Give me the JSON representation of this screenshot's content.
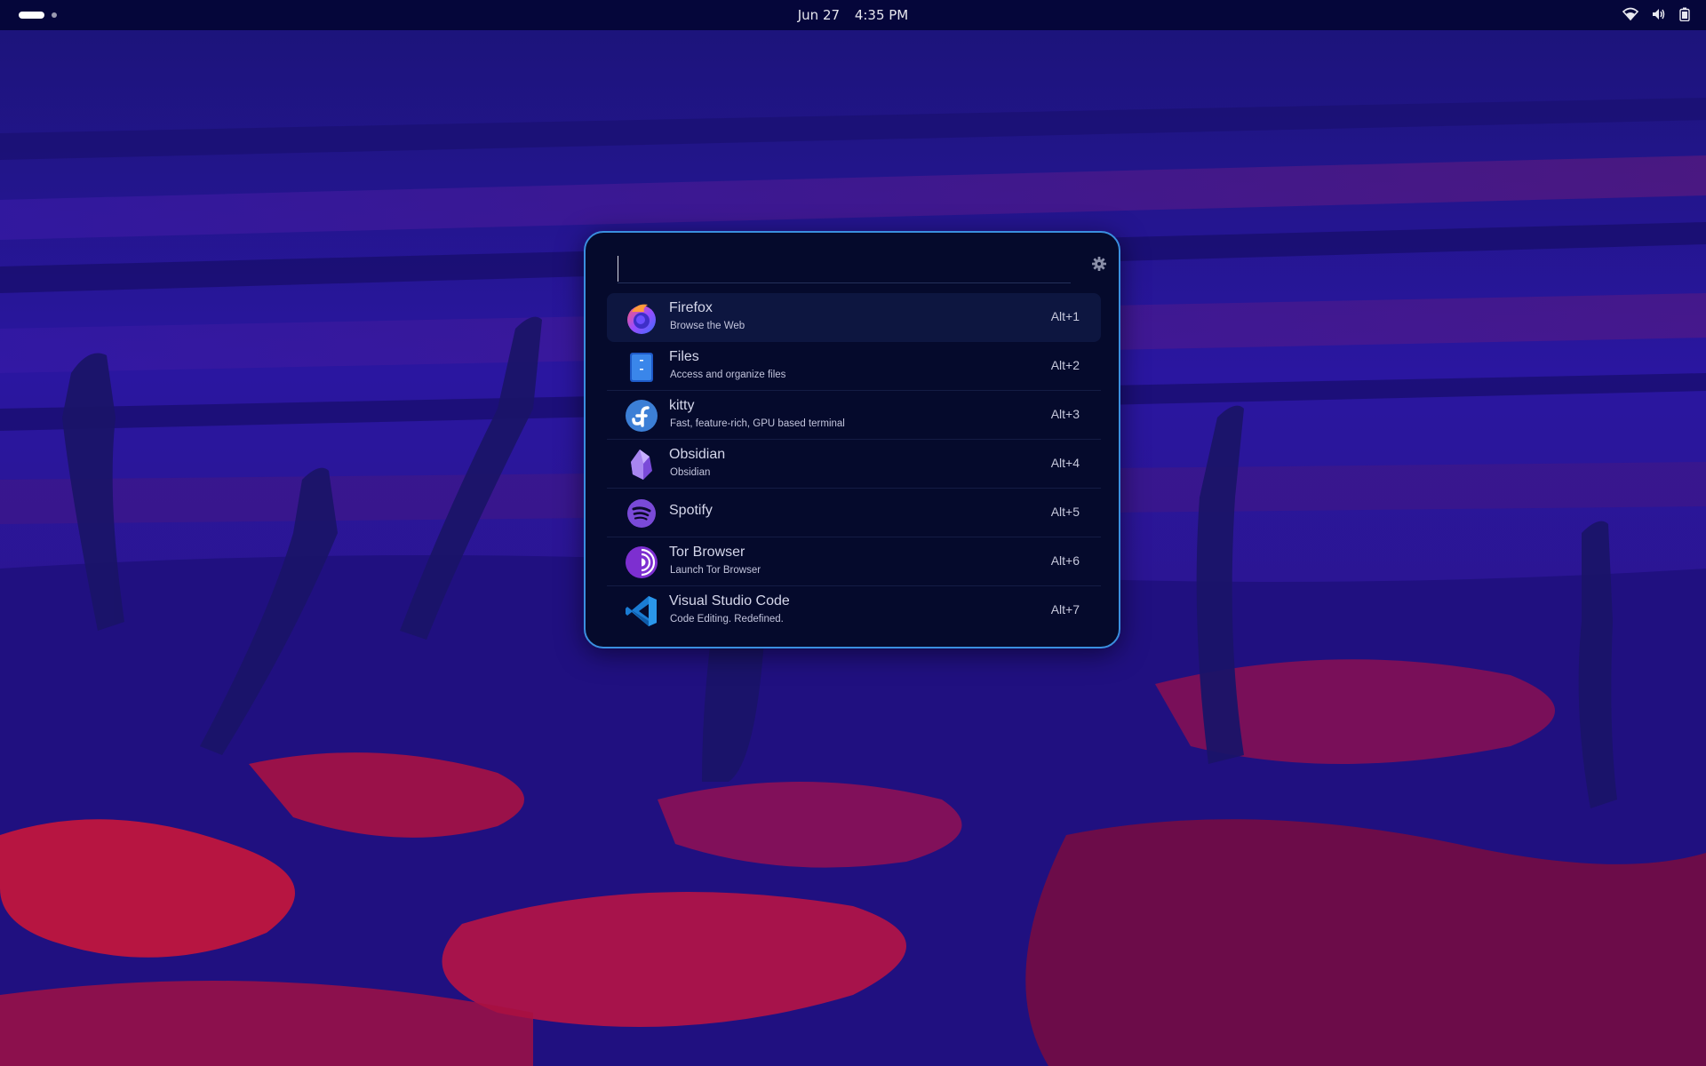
{
  "topbar": {
    "date": "Jun 27",
    "time": "4:35 PM",
    "workspaces": [
      "active",
      "inactive"
    ],
    "tray_icons": [
      "wifi-icon",
      "volume-icon",
      "battery-icon"
    ]
  },
  "launcher": {
    "search": {
      "value": "",
      "placeholder": ""
    },
    "settings_icon": "gear-icon",
    "results": [
      {
        "name": "Firefox",
        "description": "Browse the Web",
        "shortcut": "Alt+1",
        "icon": "firefox-icon",
        "selected": true
      },
      {
        "name": "Files",
        "description": "Access and organize files",
        "shortcut": "Alt+2",
        "icon": "files-icon",
        "selected": false
      },
      {
        "name": "kitty",
        "description": "Fast, feature-rich, GPU based terminal",
        "shortcut": "Alt+3",
        "icon": "fedora-icon",
        "selected": false
      },
      {
        "name": "Obsidian",
        "description": "Obsidian",
        "shortcut": "Alt+4",
        "icon": "obsidian-icon",
        "selected": false
      },
      {
        "name": "Spotify",
        "description": "",
        "shortcut": "Alt+5",
        "icon": "spotify-icon",
        "selected": false
      },
      {
        "name": "Tor Browser",
        "description": "Launch Tor Browser",
        "shortcut": "Alt+6",
        "icon": "tor-icon",
        "selected": false
      },
      {
        "name": "Visual Studio Code",
        "description": "Code Editing. Redefined.",
        "shortcut": "Alt+7",
        "icon": "vscode-icon",
        "selected": false
      }
    ]
  },
  "colors": {
    "accent_border": "#3a8fe0",
    "panel_bg": "#050a2c",
    "topbar_bg": "#05063a"
  }
}
